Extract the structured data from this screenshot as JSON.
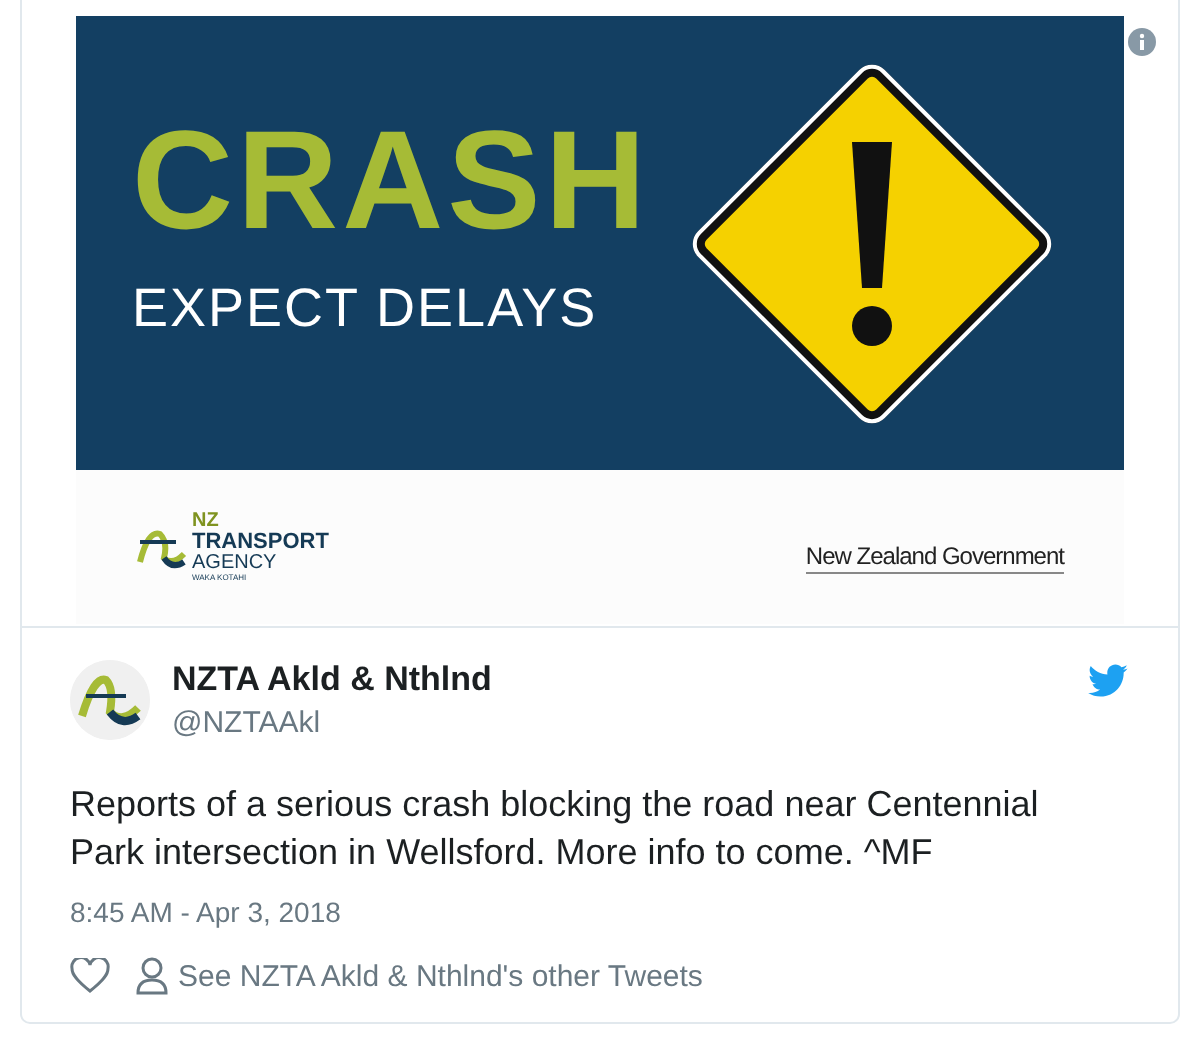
{
  "media": {
    "headline": "CRASH",
    "subheadline": "EXPECT DELAYS",
    "agency_logo": {
      "nz": "NZ",
      "line1": "TRANSPORT",
      "line2": "AGENCY",
      "line3": "WAKA KOTAHI"
    },
    "government_logo": "New Zealand Government"
  },
  "author": {
    "name": "NZTA Akld & Nthlnd",
    "handle": "@NZTAAkl"
  },
  "text": "Reports of a serious crash blocking the road near Centennial Park intersection in Wellsford. More info to come. ^MF",
  "timestamp": "8:45 AM - Apr 3, 2018",
  "actions": {
    "other_tweets": "See NZTA Akld & Nthlnd's other Tweets"
  }
}
